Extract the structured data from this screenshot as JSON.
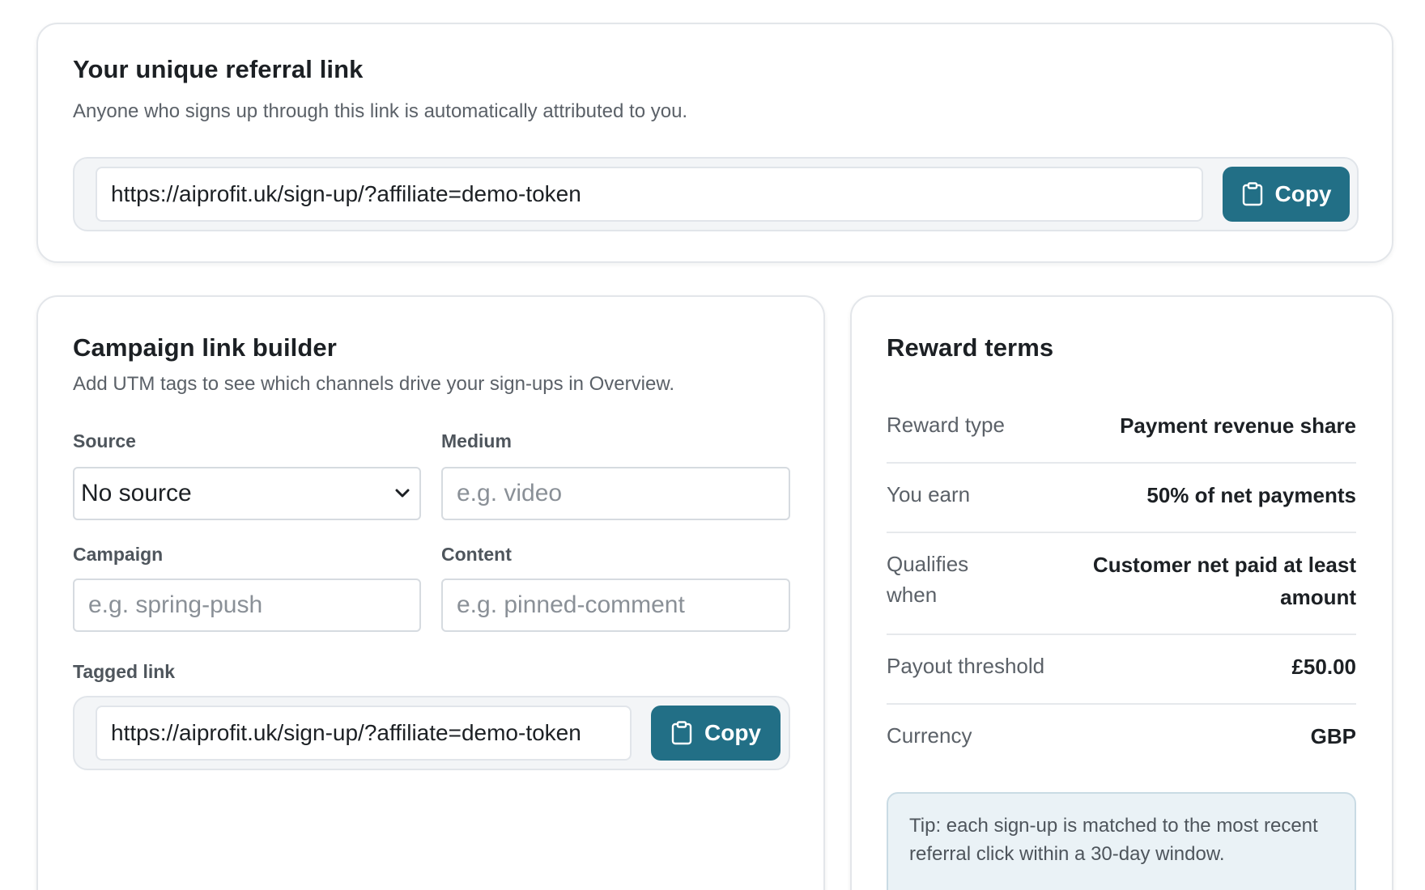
{
  "referral": {
    "title": "Your unique referral link",
    "subtitle": "Anyone who signs up through this link is automatically attributed to you.",
    "link": "https://aiprofit.uk/sign-up/?affiliate=demo-token",
    "copy_label": "Copy"
  },
  "builder": {
    "title": "Campaign link builder",
    "subtitle": "Add UTM tags to see which channels drive your sign-ups in Overview.",
    "source": {
      "label": "Source",
      "selected": "No source"
    },
    "medium": {
      "label": "Medium",
      "placeholder": "e.g. video"
    },
    "campaign": {
      "label": "Campaign",
      "placeholder": "e.g. spring-push"
    },
    "content": {
      "label": "Content",
      "placeholder": "e.g. pinned-comment"
    },
    "tagged": {
      "label": "Tagged link",
      "link": "https://aiprofit.uk/sign-up/?affiliate=demo-token",
      "copy_label": "Copy"
    }
  },
  "reward": {
    "title": "Reward terms",
    "rows": [
      {
        "label": "Reward type",
        "value": "Payment revenue share"
      },
      {
        "label": "You earn",
        "value": "50% of net payments"
      },
      {
        "label": "Qualifies when",
        "value": "Customer net paid at least amount"
      },
      {
        "label": "Payout threshold",
        "value": "£50.00"
      },
      {
        "label": "Currency",
        "value": "GBP"
      }
    ],
    "tip": "Tip: each sign-up is matched to the most recent referral click within a 30-day window."
  },
  "colors": {
    "accent": "#226f86",
    "border": "#e3e6ea",
    "tip_bg": "#eaf2f6"
  },
  "icons": {
    "copy": "clipboard-icon",
    "select": "chevron-down-icon"
  }
}
